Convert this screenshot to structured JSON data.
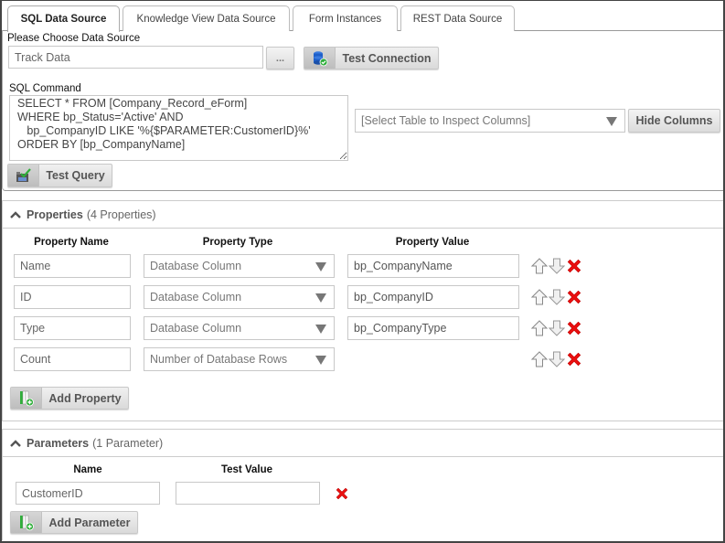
{
  "tabs": [
    {
      "label": "SQL Data Source",
      "active": true
    },
    {
      "label": "Knowledge View Data Source",
      "active": false
    },
    {
      "label": "Form Instances",
      "active": false
    },
    {
      "label": "REST Data Source",
      "active": false
    }
  ],
  "data_source": {
    "label": "Please Choose Data Source",
    "value": "Track Data",
    "browse_label": "...",
    "test_connection_label": "Test Connection"
  },
  "sql": {
    "label": "SQL Command",
    "command": "SELECT * FROM [Company_Record_eForm]\nWHERE bp_Status='Active' AND\n   bp_CompanyID LIKE '%{$PARAMETER:CustomerID}%'\nORDER BY [bp_CompanyName]",
    "test_query_label": "Test Query",
    "table_select_value": "[Select Table to Inspect Columns]",
    "hide_columns_label": "Hide Columns"
  },
  "properties": {
    "title": "Properties",
    "count_text": "(4 Properties)",
    "columns": {
      "name": "Property Name",
      "type": "Property Type",
      "value": "Property Value"
    },
    "rows": [
      {
        "name": "Name",
        "type": "Database Column",
        "value": "bp_CompanyName"
      },
      {
        "name": "ID",
        "type": "Database Column",
        "value": "bp_CompanyID"
      },
      {
        "name": "Type",
        "type": "Database Column",
        "value": "bp_CompanyType"
      },
      {
        "name": "Count",
        "type": "Number of Database Rows",
        "value": null
      }
    ],
    "add_label": "Add Property"
  },
  "parameters": {
    "title": "Parameters",
    "count_text": "(1 Parameter)",
    "columns": {
      "name": "Name",
      "test_value": "Test Value"
    },
    "rows": [
      {
        "name": "CustomerID",
        "test_value": ""
      }
    ],
    "add_label": "Add Parameter"
  },
  "colors": {
    "delete_red": "#e81010",
    "db_blue": "#1f5fc8",
    "ok_green": "#2fae3a"
  }
}
